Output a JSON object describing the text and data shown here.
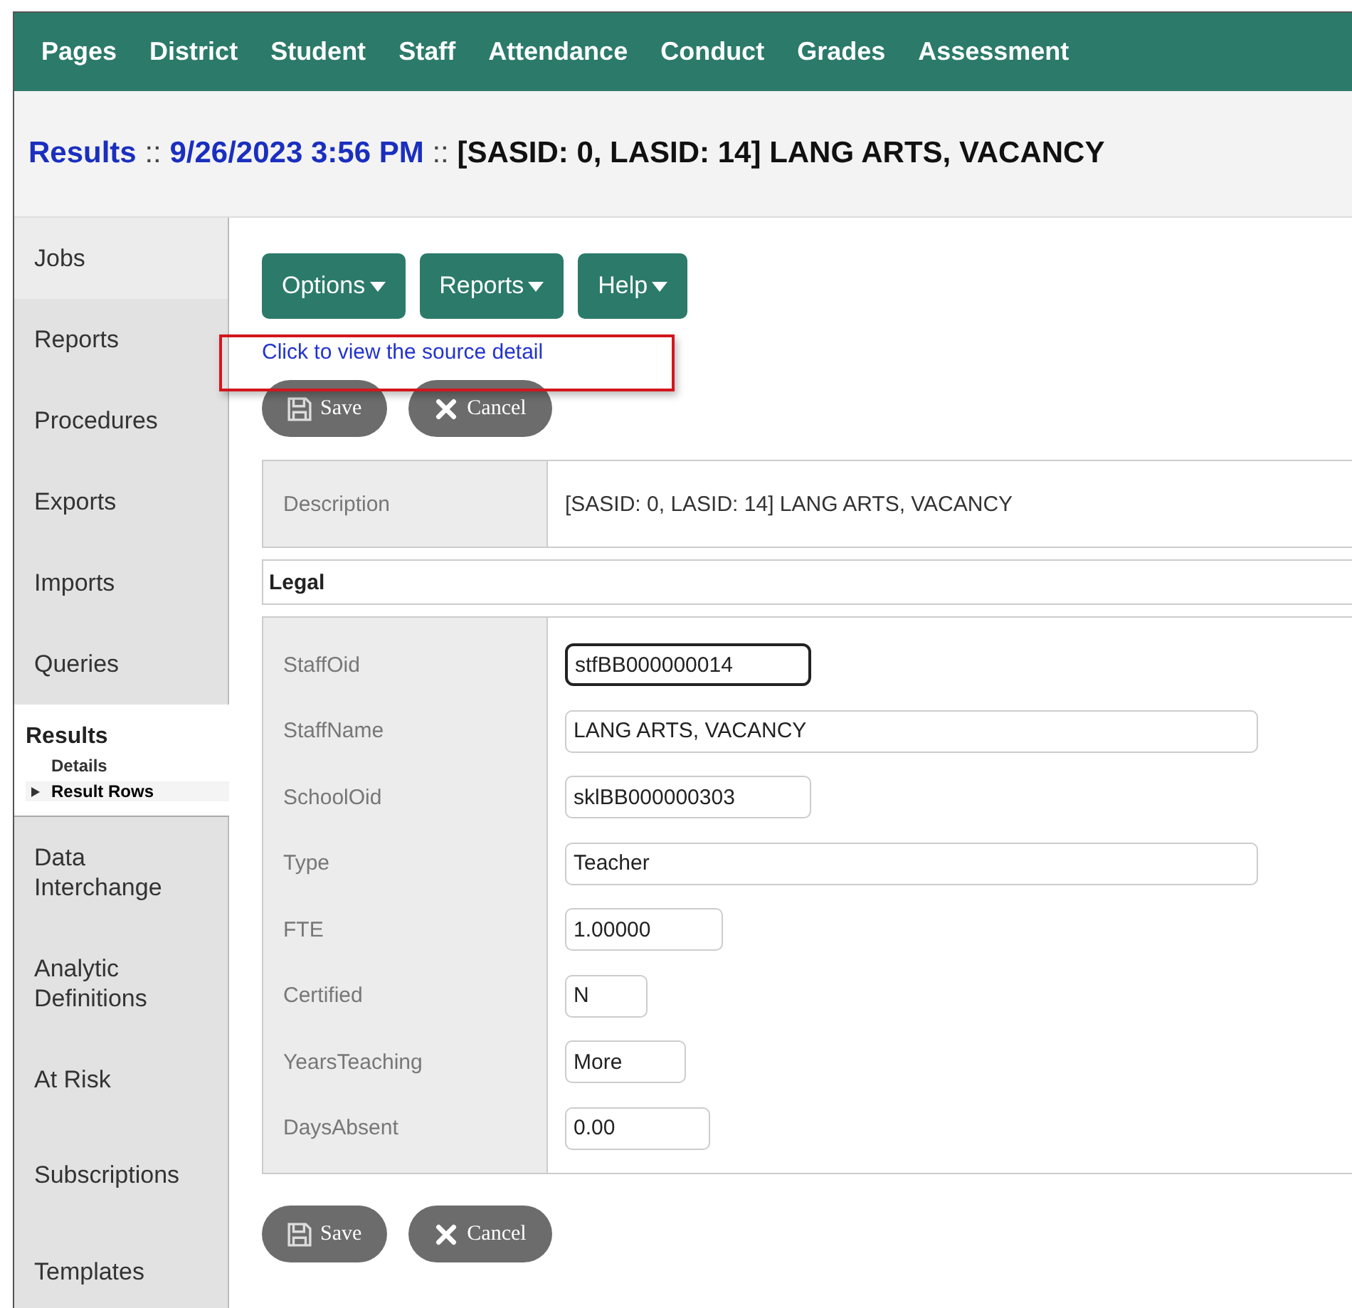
{
  "nav": [
    {
      "label": "Pages"
    },
    {
      "label": "District"
    },
    {
      "label": "Student"
    },
    {
      "label": "Staff"
    },
    {
      "label": "Attendance"
    },
    {
      "label": "Conduct"
    },
    {
      "label": "Grades"
    },
    {
      "label": "Assessment"
    }
  ],
  "title": [
    {
      "text": "Results",
      "kind": "link"
    },
    {
      "text": "::",
      "kind": "sep"
    },
    {
      "text": "9/26/2023 3:56 PM",
      "kind": "link"
    },
    {
      "text": "::",
      "kind": "sep"
    },
    {
      "text": "[SASID: 0, LASID: 14] LANG ARTS, VACANCY",
      "kind": "plain"
    }
  ],
  "sidebar": {
    "items": [
      {
        "label": "Jobs",
        "selected": false
      },
      {
        "label": "Reports",
        "selected": false
      },
      {
        "label": "Procedures",
        "selected": false
      },
      {
        "label": "Exports",
        "selected": false
      },
      {
        "label": "Imports",
        "selected": false
      },
      {
        "label": "Queries",
        "selected": false
      },
      {
        "label": "Results",
        "selected": true,
        "children": [
          {
            "label": "Details",
            "selected": false
          },
          {
            "label": "Result Rows",
            "selected": true
          }
        ]
      },
      {
        "label": "Data Interchange",
        "selected": false
      },
      {
        "label": "Analytic Definitions",
        "selected": false
      },
      {
        "label": "At Risk",
        "selected": false
      },
      {
        "label": "Subscriptions",
        "selected": false
      },
      {
        "label": "Templates",
        "selected": false
      }
    ]
  },
  "menu_buttons": [
    {
      "label": "Options"
    },
    {
      "label": "Reports"
    },
    {
      "label": "Help"
    }
  ],
  "source_link": "Click to view the source detail",
  "top_actions": [
    {
      "label": "Save",
      "kind": "save"
    },
    {
      "label": "Cancel",
      "kind": "cancel"
    }
  ],
  "description": {
    "label": "Description",
    "value": "[SASID: 0, LASID: 14] LANG ARTS, VACANCY"
  },
  "section_title": "Legal",
  "fields": [
    {
      "label": "StaffOid",
      "value": "stfBB000000014",
      "focused": true
    },
    {
      "label": "StaffName",
      "value": "LANG ARTS, VACANCY",
      "focused": false
    },
    {
      "label": "SchoolOid",
      "value": "sklBB000000303",
      "focused": false
    },
    {
      "label": "Type",
      "value": "Teacher",
      "focused": false
    },
    {
      "label": "FTE",
      "value": "1.00000",
      "focused": false
    },
    {
      "label": "Certified",
      "value": "N",
      "focused": false
    },
    {
      "label": "YearsTeaching",
      "value": "More",
      "focused": false
    },
    {
      "label": "DaysAbsent",
      "value": "0.00",
      "focused": false
    }
  ],
  "bottom_actions": [
    {
      "label": "Save",
      "kind": "save"
    },
    {
      "label": "Cancel",
      "kind": "cancel"
    }
  ]
}
